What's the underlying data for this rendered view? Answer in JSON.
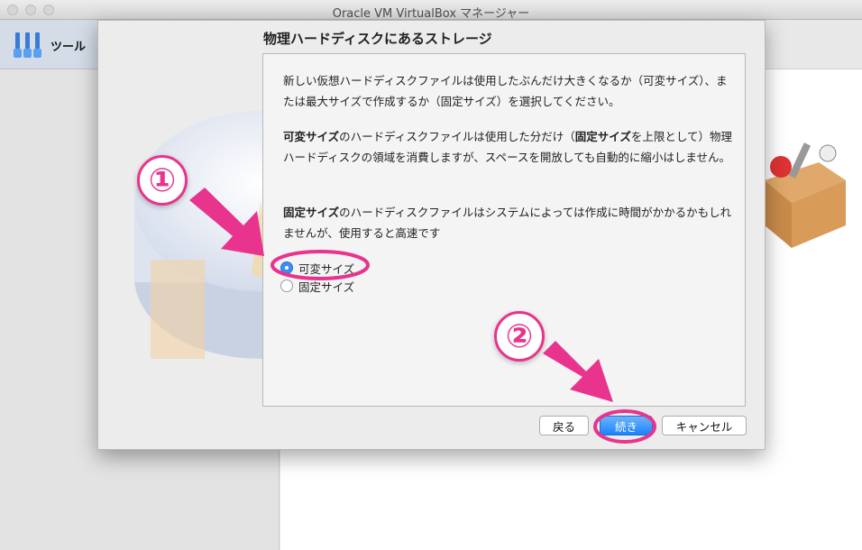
{
  "window": {
    "title": "Oracle VM VirtualBox マネージャー"
  },
  "sidebar": {
    "tools_label": "ツール"
  },
  "dialog": {
    "title": "物理ハードディスクにあるストレージ",
    "para1": "新しい仮想ハードディスクファイルは使用したぶんだけ大きくなるか（可変サイズ）、または最大サイズで作成するか（固定サイズ）を選択してください。",
    "para2_bold": "可変サイズ",
    "para2_a": "のハードディスクファイルは使用した分だけ（",
    "para2_bold2": "固定サイズ",
    "para2_b": "を上限として）物理ハードディスクの領域を消費しますが、スペースを開放しても自動的に縮小はしません。",
    "para3_bold": "固定サイズ",
    "para3_a": "のハードディスクファイルはシステムによっては作成に時間がかかるかもしれませんが、使用すると高速です",
    "options": [
      {
        "label": "可変サイズ",
        "selected": true
      },
      {
        "label": "固定サイズ",
        "selected": false
      }
    ],
    "buttons": {
      "back": "戻る",
      "continue": "続き",
      "cancel": "キャンセル"
    }
  },
  "annotations": {
    "step1": "①",
    "step2": "②",
    "accent_color": "#e8348c"
  }
}
